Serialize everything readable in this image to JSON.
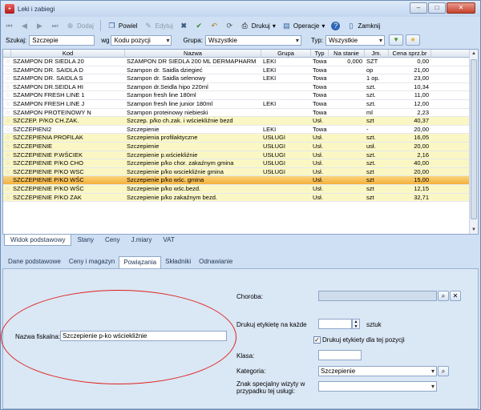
{
  "window": {
    "title": "Leki i zabiegi",
    "min": "–",
    "max": "□",
    "close": "✕"
  },
  "toolbar": {
    "add": "Dodaj",
    "repeat": "Powiel",
    "edit": "Edytuj",
    "print": "Drukuj",
    "print_arrow": "▾",
    "ops": "Operacje",
    "ops_arrow": "▾",
    "close": "Zamknij"
  },
  "filters": {
    "search_label": "Szukaj:",
    "search_value": "Szczepie",
    "wg_label": "wg",
    "wg_value": "Kodu pozycji",
    "group_label": "Grupa:",
    "group_value": "Wszystkie",
    "type_label": "Typ:",
    "type_value": "Wszystkie"
  },
  "grid": {
    "columns": [
      "Kod",
      "Nazwa",
      "Grupa",
      "Typ",
      "Na stanie",
      "Jm.",
      "Cena sprz.br"
    ],
    "rows": [
      {
        "kod": "SZAMPON DR SIEDLA 20",
        "nazwa": "SZAMPON DR SIEDLA 200 ML DERMAPHARM",
        "grupa": "LEKI",
        "typ": "Towa",
        "stan": "0,000",
        "jm": "SZT",
        "cena": "0,00",
        "usl": false
      },
      {
        "kod": "SZAMPON DR. SAIDLA D",
        "nazwa": "Szampon dr. Saidla dziegieć",
        "grupa": "LEKI",
        "typ": "Towa",
        "stan": "",
        "jm": "op",
        "cena": "21,00",
        "usl": false
      },
      {
        "kod": "SZAMPON DR. SAIDLA S",
        "nazwa": "Szampon dr. Saidla selenowy",
        "grupa": "LEKI",
        "typ": "Towa",
        "stan": "",
        "jm": "1 op.",
        "cena": "23,00",
        "usl": false
      },
      {
        "kod": "SZAMPON DR.SEIDLA HI",
        "nazwa": "Szampon dr.Seidla hipo 220ml",
        "grupa": "",
        "typ": "Towa",
        "stan": "",
        "jm": "szt.",
        "cena": "10,34",
        "usl": false
      },
      {
        "kod": "SZAMPON FRESH LINE 1",
        "nazwa": "Szampon fresh line 180ml",
        "grupa": "",
        "typ": "Towa",
        "stan": "",
        "jm": "szt.",
        "cena": "11,00",
        "usl": false
      },
      {
        "kod": "SZAMPON FRESH LINE J",
        "nazwa": "Szampon fresh line junior 180ml",
        "grupa": "LEKI",
        "typ": "Towa",
        "stan": "",
        "jm": "szt.",
        "cena": "12,00",
        "usl": false
      },
      {
        "kod": "SZAMPON PROTEINOWY N",
        "nazwa": "Szampon proteinowy niebieski",
        "grupa": "",
        "typ": "Towa",
        "stan": "",
        "jm": "ml",
        "cena": "2,23",
        "usl": false
      },
      {
        "kod": "SZCZEP. P/KO CH.ZAK.",
        "nazwa": "Szczep. p/ko ch.zak. i wściekliźnie bezd",
        "grupa": "",
        "typ": "Usł.",
        "stan": "",
        "jm": "szt",
        "cena": "40,37",
        "usl": true
      },
      {
        "kod": "SZCZEPIENI2",
        "nazwa": "Szczepienie",
        "grupa": "LEKI",
        "typ": "Towa",
        "stan": "",
        "jm": "-",
        "cena": "20,00",
        "usl": false
      },
      {
        "kod": "SZCZEPIENIA PROFILAK",
        "nazwa": "Szczepienia profilaktyczne",
        "grupa": "USŁUGI",
        "typ": "Usł.",
        "stan": "",
        "jm": "szt.",
        "cena": "16,05",
        "usl": true
      },
      {
        "kod": "SZCZEPIENIE",
        "nazwa": "Szczepienie",
        "grupa": "USŁUGI",
        "typ": "Usł.",
        "stan": "",
        "jm": "usł.",
        "cena": "20,00",
        "usl": true
      },
      {
        "kod": "SZCZEPIENIE P.WŚCIEK",
        "nazwa": "Szczepienie p.wściekliźnie",
        "grupa": "USŁUGI",
        "typ": "Usł.",
        "stan": "",
        "jm": "szt.",
        "cena": "2,16",
        "usl": true
      },
      {
        "kod": "SZCZEPIENIE P/KO CHO",
        "nazwa": "Szczepienie p/ko chor. zakaźnym gmina",
        "grupa": "USŁUGI",
        "typ": "Usł.",
        "stan": "",
        "jm": "szt.",
        "cena": "40,00",
        "usl": true
      },
      {
        "kod": "SZCZEPIENIE P/KO WSC",
        "nazwa": "Szczepienie p/ko wsciekliźnie gmina",
        "grupa": "USŁUGI",
        "typ": "Usł.",
        "stan": "",
        "jm": "szt",
        "cena": "20,00",
        "usl": true
      },
      {
        "kod": "SZCZEPIENIE P/KO WŚC",
        "nazwa": "Szczepienie p/ko wśc. gmina",
        "grupa": "",
        "typ": "Usł.",
        "stan": "",
        "jm": "szt",
        "cena": "15,00",
        "usl": true,
        "selected": true
      },
      {
        "kod": "SZCZEPIENIE P/KO WŚC",
        "nazwa": "Szczepienie p/ko wśc.bezd.",
        "grupa": "",
        "typ": "Usł.",
        "stan": "",
        "jm": "szt",
        "cena": "12,15",
        "usl": true
      },
      {
        "kod": "SZCZEPIENIE P/KO ZAK",
        "nazwa": "Szczepienie p/ko zakaźnym bezd.",
        "grupa": "",
        "typ": "Usł.",
        "stan": "",
        "jm": "szt",
        "cena": "32,71",
        "usl": true
      }
    ]
  },
  "tabs_main": [
    "Widok podstawowy",
    "Stany",
    "Ceny",
    "J.miary",
    "VAT"
  ],
  "tabs_detail": [
    "Dane podstawowe",
    "Ceny i magazyn",
    "Powiązania",
    "Składniki",
    "Odnawianie"
  ],
  "detail": {
    "fiscal_label": "Nazwa fiskalna:",
    "fiscal_value": "Szczepienie p-ko wściekliźnie",
    "disease_label": "Choroba:",
    "labels_every_label": "Drukuj etykietę na każde",
    "labels_every_unit": "sztuk",
    "print_labels_label": "Drukuj etykiety dla tej pozycji",
    "class_label": "Klasa:",
    "category_label": "Kategoria:",
    "category_value": "Szczepienie",
    "special_sign_label_1": "Znak specjalny wizyty w",
    "special_sign_label_2": "przypadku tej usługi:"
  },
  "icons": {
    "star": "☆",
    "check": "✓"
  }
}
